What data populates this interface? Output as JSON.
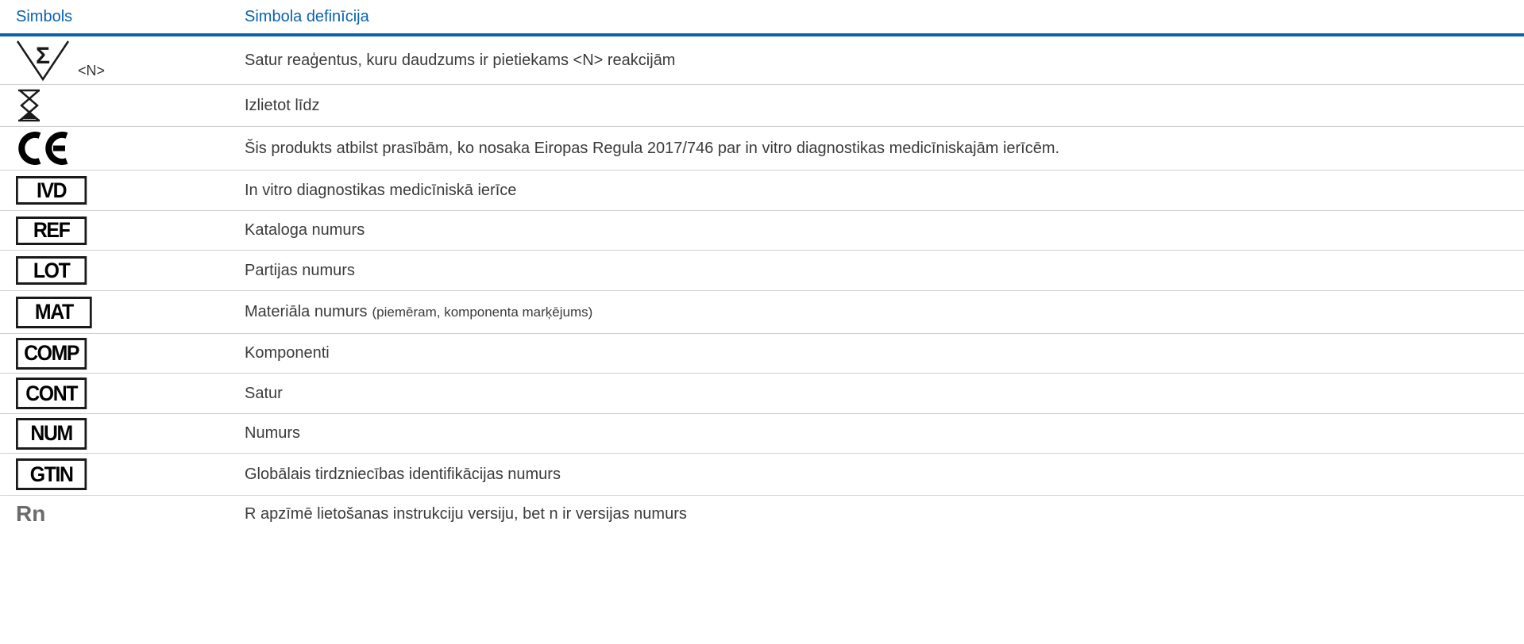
{
  "header": {
    "symbol_col": "Simbols",
    "definition_col": "Simbola definīcija"
  },
  "rows": [
    {
      "symbol_icon": "sigma-triangle-icon",
      "symbol_text": "<N>",
      "definition": "Satur reaģentus, kuru daudzums ir pietiekams <N> reakcijām"
    },
    {
      "symbol_icon": "hourglass-icon",
      "definition": "Izlietot līdz"
    },
    {
      "symbol_icon": "ce-mark-icon",
      "definition": "Šis produkts atbilst prasībām, ko nosaka Eiropas Regula 2017/746 par in vitro diagnostikas medicīniskajām ierīcēm."
    },
    {
      "symbol_text": "IVD",
      "definition": "In vitro diagnostikas medicīniskā ierīce"
    },
    {
      "symbol_text": "REF",
      "definition": "Kataloga numurs"
    },
    {
      "symbol_text": "LOT",
      "definition": "Partijas numurs"
    },
    {
      "symbol_text": "MAT",
      "definition": "Materiāla numurs",
      "definition_note": "(piemēram, komponenta marķējums)"
    },
    {
      "symbol_text": "COMP",
      "definition": "Komponenti"
    },
    {
      "symbol_text": "CONT",
      "definition": "Satur"
    },
    {
      "symbol_text": "NUM",
      "definition": "Numurs"
    },
    {
      "symbol_text": "GTIN",
      "definition": "Globālais tirdzniecības identifikācijas numurs"
    },
    {
      "symbol_text": "Rn",
      "definition": "R apzīmē lietošanas instrukciju versiju, bet n ir versijas numurs"
    }
  ],
  "colors": {
    "header_blue": "#0a62ad",
    "row_border": "#cfcfcf",
    "text": "#3b3b3b"
  }
}
